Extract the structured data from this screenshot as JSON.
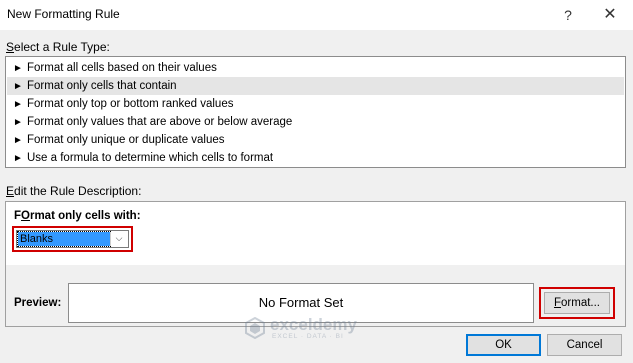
{
  "window": {
    "title": "New Formatting Rule",
    "help_glyph": "?",
    "close_glyph": "✕"
  },
  "rule_type": {
    "label_prefix": "S",
    "label_rest": "elect a Rule Type:",
    "items": [
      {
        "label": "Format all cells based on their values",
        "selected": false
      },
      {
        "label": "Format only cells that contain",
        "selected": true
      },
      {
        "label": "Format only top or bottom ranked values",
        "selected": false
      },
      {
        "label": "Format only values that are above or below average",
        "selected": false
      },
      {
        "label": "Format only unique or duplicate values",
        "selected": false
      },
      {
        "label": "Use a formula to determine which cells to format",
        "selected": false
      }
    ],
    "arrow_glyph": "►"
  },
  "description": {
    "label_prefix": "E",
    "label_rest": "dit the Rule Description:",
    "format_only_prefix": "O",
    "format_only_label_start": "F",
    "format_only_label_middle": "rmat only cells with:",
    "condition_value": "Blanks",
    "dropdown_glyph": "⌵",
    "preview_label": "Preview:",
    "preview_text": "No Format Set",
    "format_button_prefix": "F",
    "format_button_rest": "ormat..."
  },
  "watermark": {
    "name": "exceldemy",
    "tagline": "EXCEL · DATA · BI"
  },
  "buttons": {
    "ok": "OK",
    "cancel": "Cancel"
  },
  "colors": {
    "highlight_border": "#d00000",
    "selection_blue": "#3399ff",
    "ok_border": "#0078d7"
  }
}
